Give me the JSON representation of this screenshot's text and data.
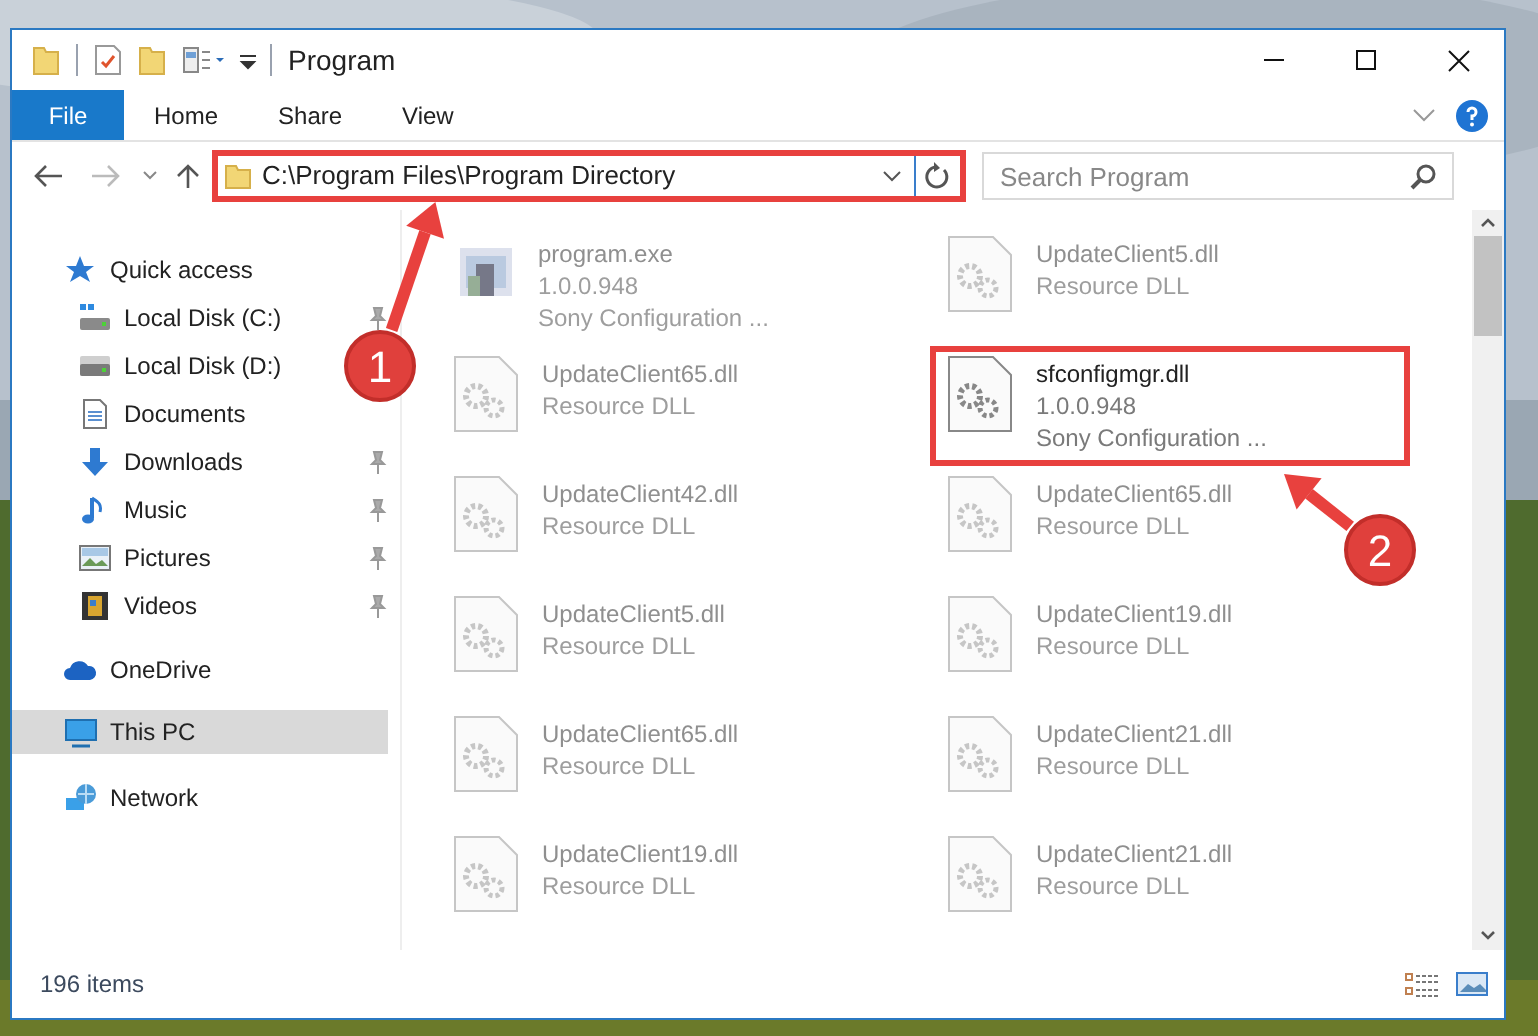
{
  "window": {
    "title": "Program"
  },
  "ribbon_tabs": [
    {
      "label": "File",
      "kind": "menu"
    },
    {
      "label": "Home",
      "kind": "tab"
    },
    {
      "label": "Share",
      "kind": "tab"
    },
    {
      "label": "View",
      "kind": "tab"
    }
  ],
  "address": {
    "path": "C:\\Program Files\\Program Directory",
    "annotated": true
  },
  "search": {
    "placeholder": "Search Program"
  },
  "navigation": [
    {
      "label": "Quick access",
      "kind": "star",
      "selected": false,
      "children": [
        {
          "label": "Local Disk (C:)",
          "kind": "system-drive",
          "pinned": true,
          "selected": false
        },
        {
          "label": "Local Disk (D:)",
          "kind": "drive",
          "pinned": false,
          "selected": false
        },
        {
          "label": "Documents",
          "kind": "documents",
          "pinned": false,
          "selected": false
        },
        {
          "label": "Downloads",
          "kind": "downloads",
          "pinned": true,
          "selected": false
        },
        {
          "label": "Music",
          "kind": "music",
          "pinned": true,
          "selected": false
        },
        {
          "label": "Pictures",
          "kind": "pictures",
          "pinned": true,
          "selected": false
        },
        {
          "label": "Videos",
          "kind": "videos",
          "pinned": true,
          "selected": false
        }
      ]
    },
    {
      "label": "OneDrive",
      "kind": "cloud",
      "selected": false
    },
    {
      "label": "This PC",
      "kind": "pc",
      "selected": true
    },
    {
      "label": "Network",
      "kind": "network",
      "selected": false
    }
  ],
  "files": [
    {
      "name": "program.exe",
      "details": [
        "1.0.0.948",
        "Sony Configuration ..."
      ],
      "kind": "exe",
      "annotated": false
    },
    {
      "name": "UpdateClient5.dll",
      "details": [
        "Resource DLL"
      ],
      "kind": "dll",
      "annotated": false
    },
    {
      "name": "UpdateClient65.dll",
      "details": [
        "Resource DLL"
      ],
      "kind": "dll",
      "annotated": false
    },
    {
      "name": "sfconfigmgr.dll",
      "details": [
        "1.0.0.948",
        "Sony Configuration ..."
      ],
      "kind": "dll",
      "annotated": true
    },
    {
      "name": "UpdateClient42.dll",
      "details": [
        "Resource DLL"
      ],
      "kind": "dll",
      "annotated": false
    },
    {
      "name": "UpdateClient65.dll",
      "details": [
        "Resource DLL"
      ],
      "kind": "dll",
      "annotated": false
    },
    {
      "name": "UpdateClient5.dll",
      "details": [
        "Resource DLL"
      ],
      "kind": "dll",
      "annotated": false
    },
    {
      "name": "UpdateClient19.dll",
      "details": [
        "Resource DLL"
      ],
      "kind": "dll",
      "annotated": false
    },
    {
      "name": "UpdateClient65.dll",
      "details": [
        "Resource DLL"
      ],
      "kind": "dll",
      "annotated": false
    },
    {
      "name": "UpdateClient21.dll",
      "details": [
        "Resource DLL"
      ],
      "kind": "dll",
      "annotated": false
    },
    {
      "name": "UpdateClient19.dll",
      "details": [
        "Resource DLL"
      ],
      "kind": "dll",
      "annotated": false
    },
    {
      "name": "UpdateClient21.dll",
      "details": [
        "Resource DLL"
      ],
      "kind": "dll",
      "annotated": false
    }
  ],
  "status_bar": {
    "item_count": "196 items"
  },
  "annotations": [
    {
      "label": "1"
    },
    {
      "label": "2"
    }
  ]
}
